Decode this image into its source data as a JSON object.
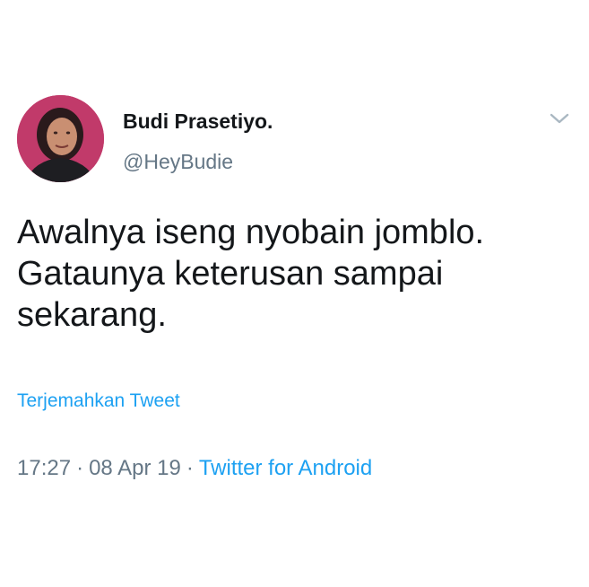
{
  "tweet": {
    "display_name": "Budi Prasetiyo.",
    "handle": "@HeyBudie",
    "text_lines": [
      "Awalnya iseng nyobain jomblo.",
      "Gataunya keterusan sampai",
      "sekarang."
    ],
    "translate_label": "Terjemahkan Tweet",
    "time": "17:27",
    "date": "08 Apr 19",
    "separator": "·",
    "source": "Twitter for Android"
  },
  "icons": {
    "menu": "chevron-down-icon",
    "avatar": "avatar"
  },
  "colors": {
    "link": "#1da1f2",
    "secondary_text": "#657786",
    "primary_text": "#14171a",
    "avatar_background": "#c13a6a"
  }
}
